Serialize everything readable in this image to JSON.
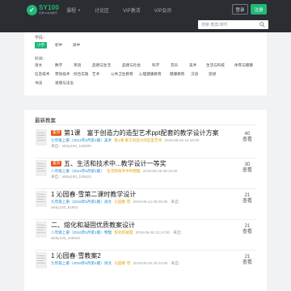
{
  "header": {
    "logo_name": "SY100",
    "logo_sub": "善源100在线教育",
    "nav": [
      {
        "label": "课程",
        "caret": true
      },
      {
        "label": "讨论区",
        "caret": false
      },
      {
        "label": "VIP激活",
        "caret": false
      },
      {
        "label": "VIP会员",
        "caret": false
      }
    ],
    "login_label": "登录",
    "register_label": "注册"
  },
  "search": {
    "placeholder": "搜索 教案/课件"
  },
  "filters": {
    "stage_label": "学段：",
    "stages": [
      "小学",
      "初中",
      "高中"
    ],
    "active_stage": "小学",
    "subject_label": "科目：",
    "subjects_row1": [
      "语文",
      "数学",
      "英语",
      "品德与生活",
      "品德与社会",
      "科学",
      "音乐",
      "美术",
      "生活与科技",
      "体育与健康"
    ],
    "subjects_row2": [
      "信息技术",
      "劳动技术",
      "综合实践",
      "艺术",
      "公共卫生教育",
      "心理健康教育",
      "健康教育",
      "汉语",
      "思想"
    ],
    "subjects_row3": [
      "书法",
      "道德与法治"
    ]
  },
  "list": {
    "title": "最新教案",
    "items": [
      {
        "hot": true,
        "hot_label": "置顶",
        "title": "第1课　富于创造力的造型艺术ppt配套的教学设计方案",
        "grade": "七年级上册（2012年6月第1版）美术",
        "category": "第1课 富于创造力的造型艺术",
        "time": "2019-06-20 14:16:00",
        "source": "来自：",
        "author": "来自：wk5y100_128405",
        "count": "40",
        "count_label": "查看"
      },
      {
        "hot": true,
        "hot_label": "置顶",
        "title": "五、生活和技术中...教学设计一等奖",
        "grade": "八年级上册（2012年6月第1版）",
        "category": "生活和技术中的物理",
        "time": "2019-06-18 09:10:00",
        "source": "来自：",
        "author": "来自：wk5y100_105523",
        "count": "30",
        "count_label": "查看"
      },
      {
        "hot": false,
        "hot_label": "",
        "title": "1 沁园春·雪第二课时教学设计",
        "grade": "九年级上册（2018年6月第1版）语文",
        "category": "沁园春·雪",
        "time": "2019-06-12 08:25:00",
        "source": "来自：",
        "author": "wk5y100_81901",
        "count": "21",
        "count_label": "查看"
      },
      {
        "hot": false,
        "hot_label": "",
        "title": "二、熔化和凝固优质教案设计",
        "grade": "八年级上册（2016年6月第1版）物理",
        "category": "熔化和凝固",
        "time": "2019-06-30 11:14:00",
        "source": "来自：",
        "author": "wk5y100_106520",
        "count": "21",
        "count_label": "查看"
      },
      {
        "hot": false,
        "hot_label": "",
        "title": "1 沁园春·雪教案2",
        "grade": "九年级上册（2018年6月第1版）语文",
        "category": "沁园春·雪",
        "time": "2019-05-25 15:14:00",
        "source": "来自：",
        "author": "",
        "count": "21",
        "count_label": "查看"
      }
    ]
  },
  "colors": {
    "accent": "#21b878",
    "hot": "#e8561c",
    "link": "#1a8ed1",
    "topbar": "#2a2d31"
  }
}
